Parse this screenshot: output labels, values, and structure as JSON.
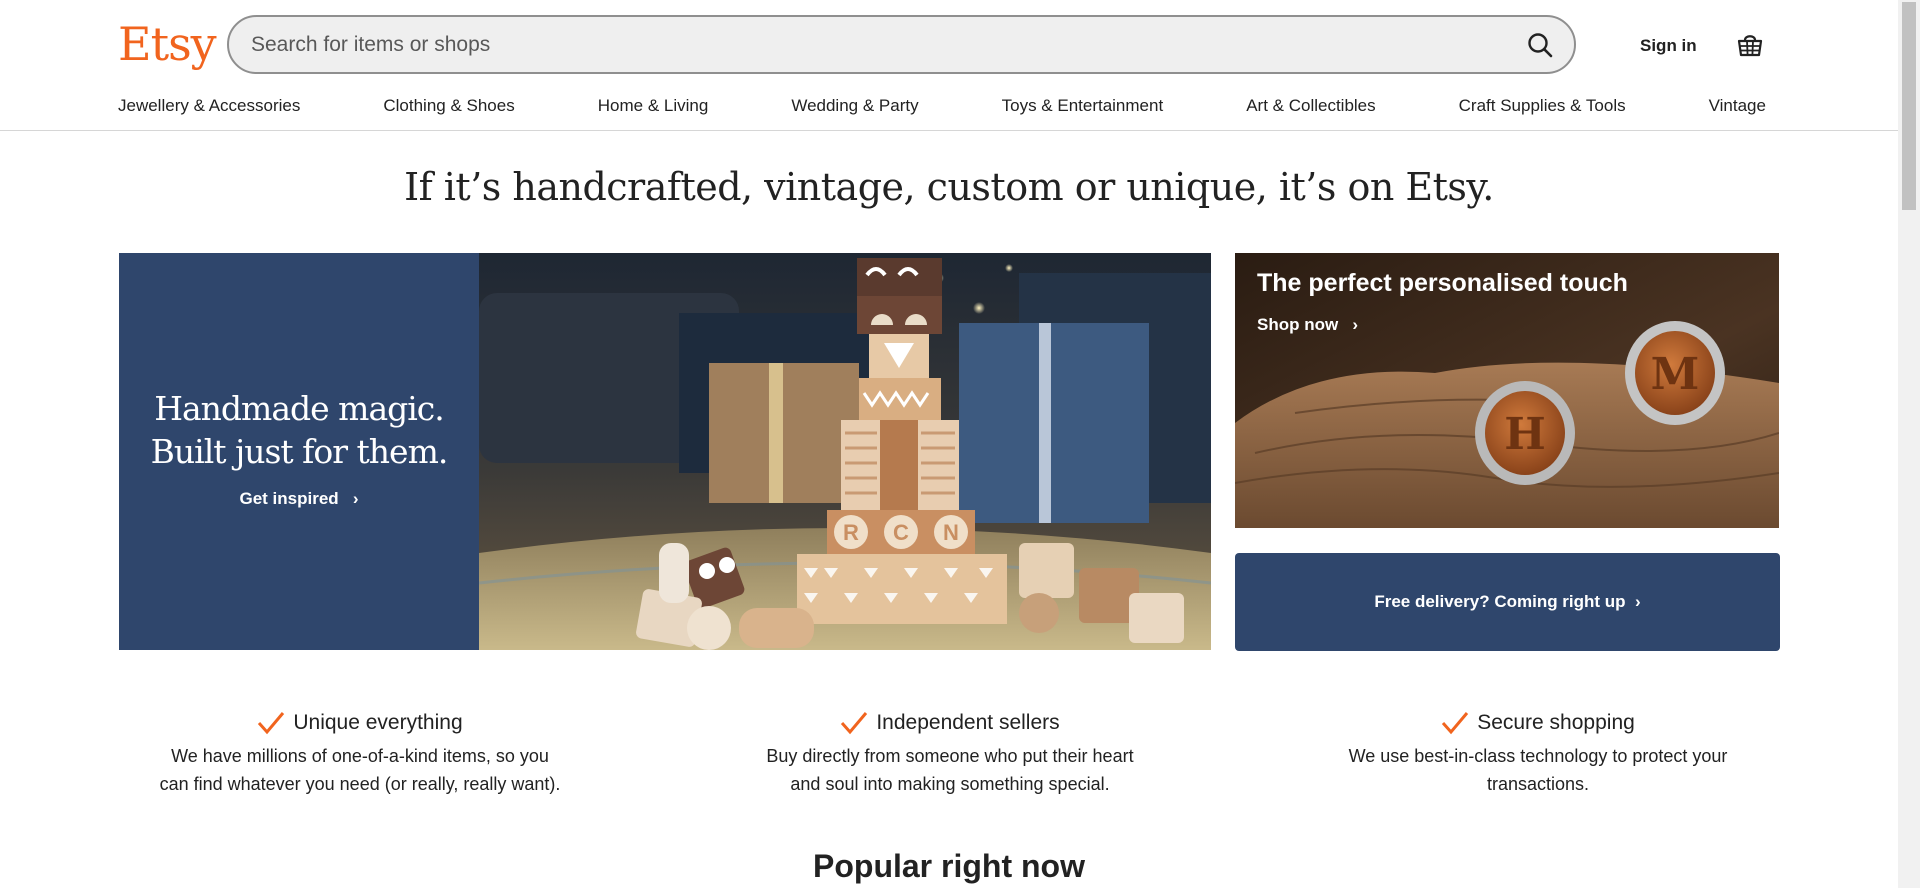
{
  "header": {
    "logo": "Etsy",
    "search_placeholder": "Search for items or shops",
    "sign_in": "Sign in",
    "basket_icon": "basket-icon"
  },
  "categories": [
    "Jewellery & Accessories",
    "Clothing & Shoes",
    "Home & Living",
    "Wedding & Party",
    "Toys & Entertainment",
    "Art & Collectibles",
    "Craft Supplies & Tools",
    "Vintage"
  ],
  "hero": {
    "tagline": "If it’s handcrafted, vintage, custom or unique, it’s on Etsy.",
    "headline_line1": "Handmade magic.",
    "headline_line2": "Built just for them.",
    "cta": "Get inspired"
  },
  "promo": {
    "title": "The perfect personalised touch",
    "cta": "Shop now"
  },
  "delivery": {
    "label": "Free delivery? Coming right up"
  },
  "value_props": [
    {
      "title": "Unique everything",
      "line1": "We have millions of one-of-a-kind items, so you",
      "line2": "can find whatever you need (or really, really want)."
    },
    {
      "title": "Independent sellers",
      "line1": "Buy directly from someone who put their heart",
      "line2": "and soul into making something special."
    },
    {
      "title": "Secure shopping",
      "line1": "We use best-in-class technology to protect your",
      "line2": "transactions."
    }
  ],
  "section_title": "Popular right now",
  "colors": {
    "brand": "#f1641e",
    "navy": "#2f466c",
    "check": "#f1641e"
  }
}
